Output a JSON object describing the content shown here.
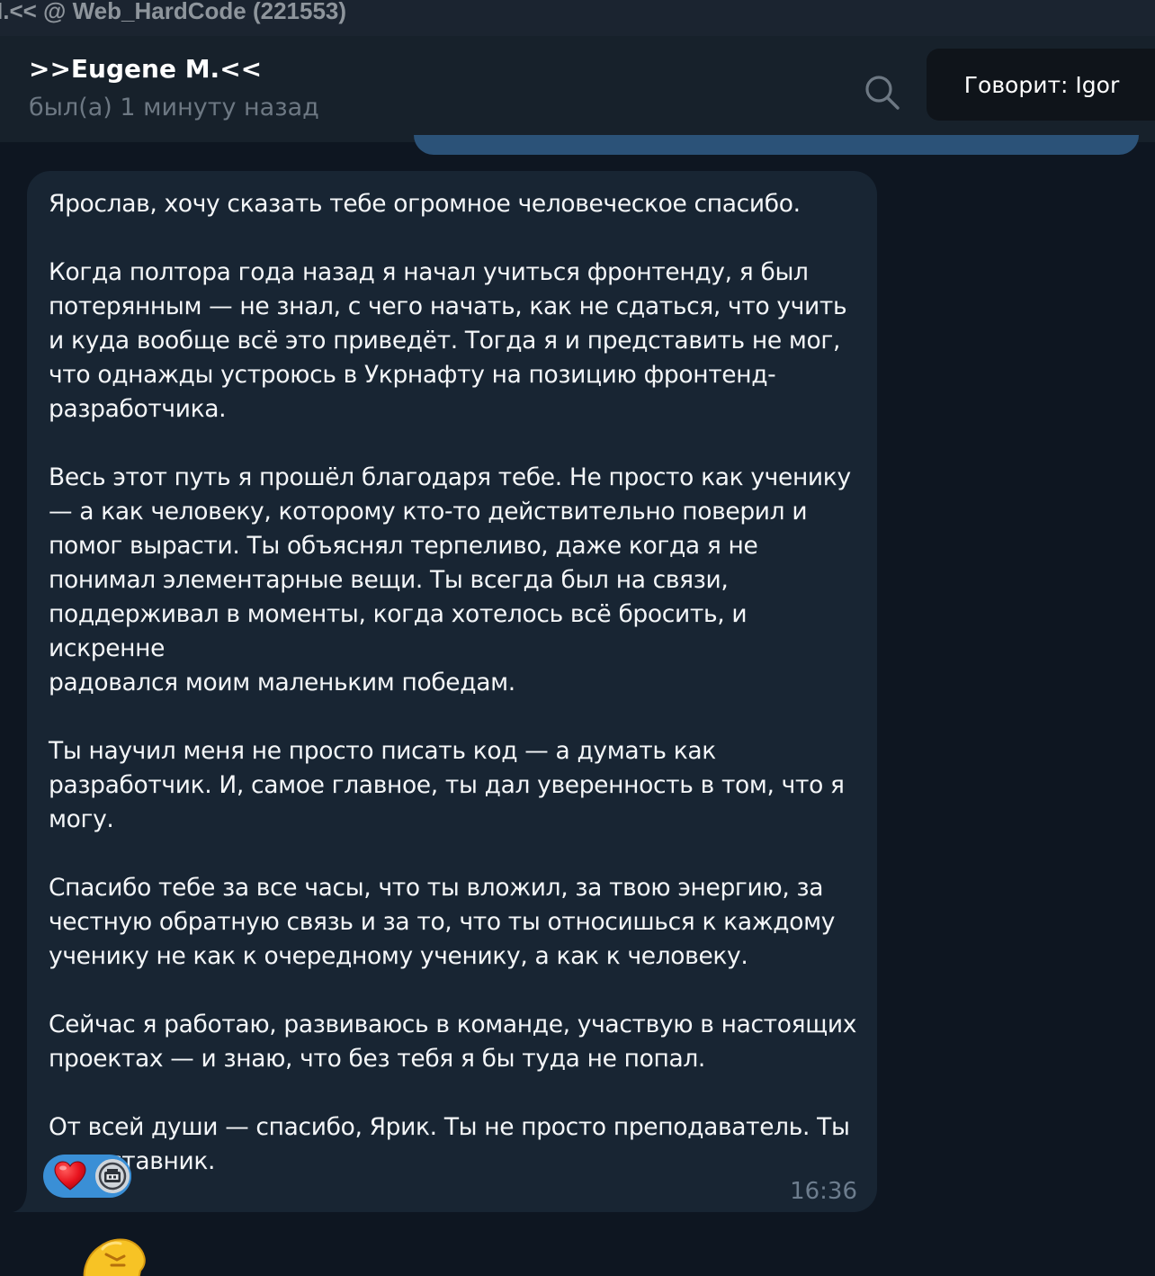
{
  "window": {
    "title": "I.<< @ Web_HardCode (221553)"
  },
  "header": {
    "peer_name": ">>Eugene M.<<",
    "status": "был(а) 1 минуту назад",
    "speaker_label": "Говорит: Igor"
  },
  "message": {
    "text": "Ярослав, хочу сказать тебе огромное человеческое спасибо.\n\nКогда полтора года назад я начал учиться фронтенду, я был\nпотерянным — не знал, с чего начать, как не сдаться, что учить\nи куда вообще всё это приведёт. Тогда я и представить не мог,\nчто однажды устроюсь в Укрнафту на позицию фронтенд-\nразработчика.\n\nВесь этот путь я прошёл благодаря тебе. Не просто как ученику\n— а как человеку, которому кто-то действительно поверил и\nпомог вырасти. Ты объяснял терпеливо, даже когда я не\nпонимал элементарные вещи. Ты всегда был на связи,\nподдерживал в моменты, когда хотелось всё бросить, и искренне\nрадовался моим маленьким победам.\n\nТы научил меня не просто писать код — а думать как\nразработчик. И, самое главное, ты дал уверенность в том, что я\nмогу.\n\nСпасибо тебе за все часы, что ты вложил, за твою энергию, за\nчестную обратную связь и за то, что ты относишься к каждому\nученику не как к очередному ученику, а как к человеку.\n\nСейчас я работаю, развиваюсь в команде, участвую в настоящих\nпроектах — и знаю, что без тебя я бы туда не попал.\n\nОт всей души — спасибо, Ярик. Ты не просто преподаватель. Ты\n— наставник.",
    "time": "16:36",
    "reaction_emoji": "heart-icon"
  },
  "colors": {
    "background": "#0e1621",
    "header": "#17212b",
    "bubble_incoming": "#182533",
    "bubble_outgoing": "#2b5278",
    "reaction_bg": "#3a8fd6",
    "muted_text": "#6d7883"
  }
}
